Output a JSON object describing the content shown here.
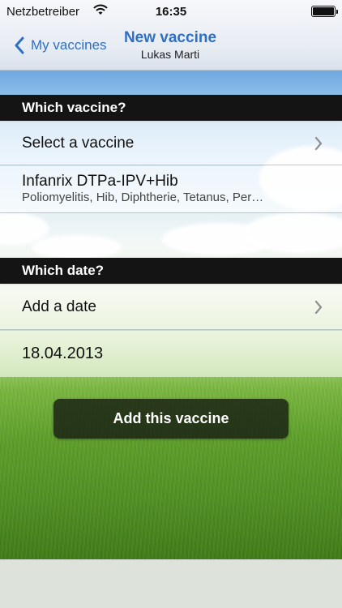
{
  "status_bar": {
    "carrier": "Netzbetreiber",
    "time": "16:35",
    "wifi_icon": "wifi-icon",
    "battery_level": 0.95
  },
  "nav": {
    "back_label": "My vaccines",
    "title": "New vaccine",
    "subtitle": "Lukas Marti",
    "accent_color": "#2f6fc3"
  },
  "vaccine_section": {
    "header": "Which vaccine?",
    "select_label": "Select a vaccine",
    "selected_name": "Infanrix DTPa-IPV+Hib",
    "selected_diseases": "Poliomyelitis, Hib, Diphtherie, Tetanus, Per…"
  },
  "date_section": {
    "header": "Which date?",
    "add_label": "Add a date",
    "selected_date": "18.04.2013"
  },
  "actions": {
    "add_button": "Add this vaccine"
  }
}
